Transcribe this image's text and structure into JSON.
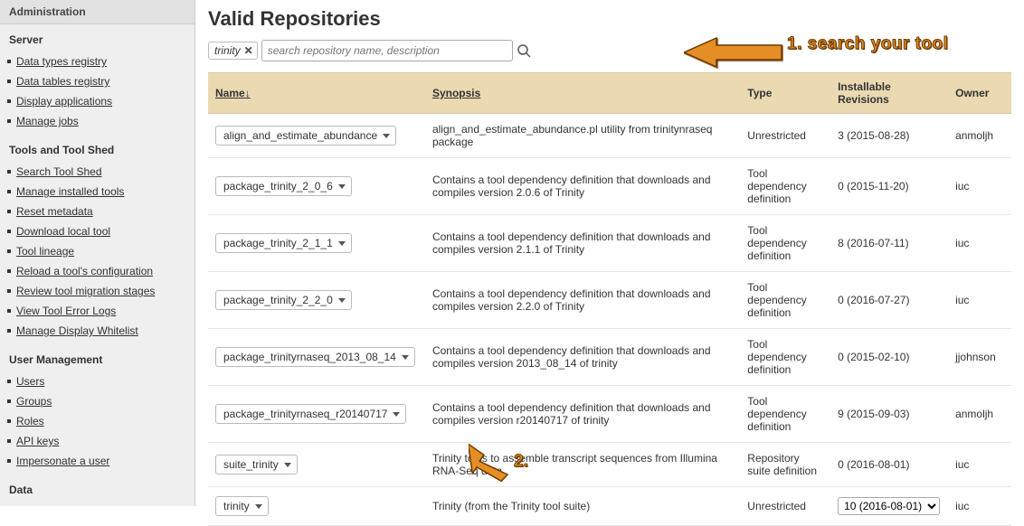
{
  "sidebar": {
    "title": "Administration",
    "sections": [
      {
        "title": "Server",
        "items": [
          "Data types registry",
          "Data tables registry",
          "Display applications",
          "Manage jobs"
        ]
      },
      {
        "title": "Tools and Tool Shed",
        "items": [
          "Search Tool Shed",
          "Manage installed tools",
          "Reset metadata",
          "Download local tool",
          "Tool lineage",
          "Reload a tool's configuration",
          "Review tool migration stages",
          "View Tool Error Logs",
          "Manage Display Whitelist"
        ]
      },
      {
        "title": "User Management",
        "items": [
          "Users",
          "Groups",
          "Roles",
          "API keys",
          "Impersonate a user"
        ]
      },
      {
        "title": "Data",
        "items": []
      }
    ]
  },
  "page": {
    "title": "Valid Repositories",
    "search": {
      "tag": "trinity",
      "placeholder": "search repository name, description"
    }
  },
  "annotations": {
    "step1": "1. search your tool",
    "step2": "2."
  },
  "table": {
    "headers": {
      "name": "Name",
      "name_sort_indicator": "↓",
      "synopsis": "Synopsis",
      "type": "Type",
      "revisions": "Installable Revisions",
      "owner": "Owner"
    },
    "rows": [
      {
        "name": "align_and_estimate_abundance",
        "synopsis": "align_and_estimate_abundance.pl utility from trinitynraseq package",
        "type": "Unrestricted",
        "revisions": "3 (2015-08-28)",
        "owner": "anmoljh"
      },
      {
        "name": "package_trinity_2_0_6",
        "synopsis": "Contains a tool dependency definition that downloads and compiles version 2.0.6 of Trinity",
        "type": "Tool dependency definition",
        "revisions": "0 (2015-11-20)",
        "owner": "iuc"
      },
      {
        "name": "package_trinity_2_1_1",
        "synopsis": "Contains a tool dependency definition that downloads and compiles version 2.1.1 of Trinity",
        "type": "Tool dependency definition",
        "revisions": "8 (2016-07-11)",
        "owner": "iuc"
      },
      {
        "name": "package_trinity_2_2_0",
        "synopsis": "Contains a tool dependency definition that downloads and compiles version 2.2.0 of Trinity",
        "type": "Tool dependency definition",
        "revisions": "0 (2016-07-27)",
        "owner": "iuc"
      },
      {
        "name": "package_trinityrnaseq_2013_08_14",
        "synopsis": "Contains a tool dependency definition that downloads and compiles version 2013_08_14 of trinity",
        "type": "Tool dependency definition",
        "revisions": "0 (2015-02-10)",
        "owner": "jjohnson"
      },
      {
        "name": "package_trinityrnaseq_r20140717",
        "synopsis": "Contains a tool dependency definition that downloads and compiles version r20140717 of trinity",
        "type": "Tool dependency definition",
        "revisions": "9 (2015-09-03)",
        "owner": "anmoljh"
      },
      {
        "name": "suite_trinity",
        "synopsis": "Trinity tools to assemble transcript sequences from Illumina RNA-Seq data.",
        "type": "Repository suite definition",
        "revisions": "0 (2016-08-01)",
        "owner": "iuc"
      },
      {
        "name": "trinity",
        "synopsis": "Trinity (from the Trinity tool suite)",
        "type": "Unrestricted",
        "revisions_select": "10 (2016-08-01)",
        "owner": "iuc"
      }
    ]
  }
}
